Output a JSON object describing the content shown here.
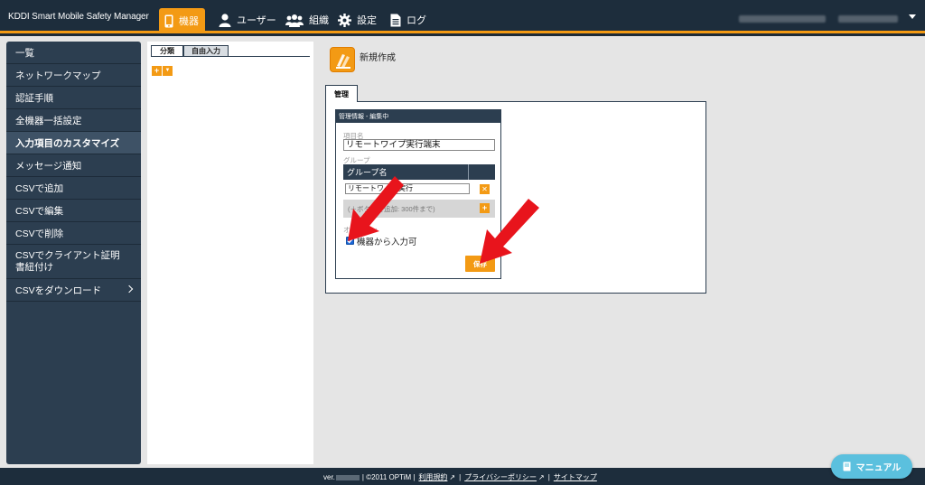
{
  "header": {
    "brand": "KDDI Smart Mobile Safety Manager",
    "nav": {
      "device": "機器",
      "user": "ユーザー",
      "org": "組織",
      "settings": "設定",
      "log": "ログ"
    }
  },
  "sidebar": {
    "items": [
      {
        "label": "一覧"
      },
      {
        "label": "ネットワークマップ"
      },
      {
        "label": "認証手順"
      },
      {
        "label": "全機器一括設定"
      },
      {
        "label": "入力項目のカスタマイズ"
      },
      {
        "label": "メッセージ通知"
      },
      {
        "label": "CSVで追加"
      },
      {
        "label": "CSVで編集"
      },
      {
        "label": "CSVで削除"
      },
      {
        "label": "CSVでクライアント証明書紐付け"
      },
      {
        "label": "CSVをダウンロード"
      }
    ]
  },
  "tree_panel": {
    "tabs": [
      "分類",
      "自由入力"
    ],
    "add_symbol": "+",
    "dropdown_symbol": "▼"
  },
  "content": {
    "title": "新規作成",
    "tab": "管理",
    "edit_box": {
      "header": "管理情報 - 編集中",
      "item_name_label": "項目名",
      "item_name_value": "リモートワイプ実行端末",
      "group_label": "グループ",
      "group_column": "グループ名",
      "group_value": "リモートワイプ実行",
      "add_hint": "(＋ボタンで追加: 300件まで)",
      "option_label": "オプション",
      "option_checkbox": "機器から入力可",
      "checkbox_checked": true,
      "save_button": "保存"
    }
  },
  "footer": {
    "ver": "ver.",
    "copyright": "| ©2011 OPTiM |",
    "terms": "利用規約",
    "privacy": "プライバシーポリシー",
    "sitemap": "サイトマップ",
    "sep": "|"
  },
  "manual_button": "マニュアル",
  "colors": {
    "accent": "#f39a14",
    "navy": "#2c3e50",
    "manual": "#5bc0de",
    "arrow": "#e8141c"
  }
}
